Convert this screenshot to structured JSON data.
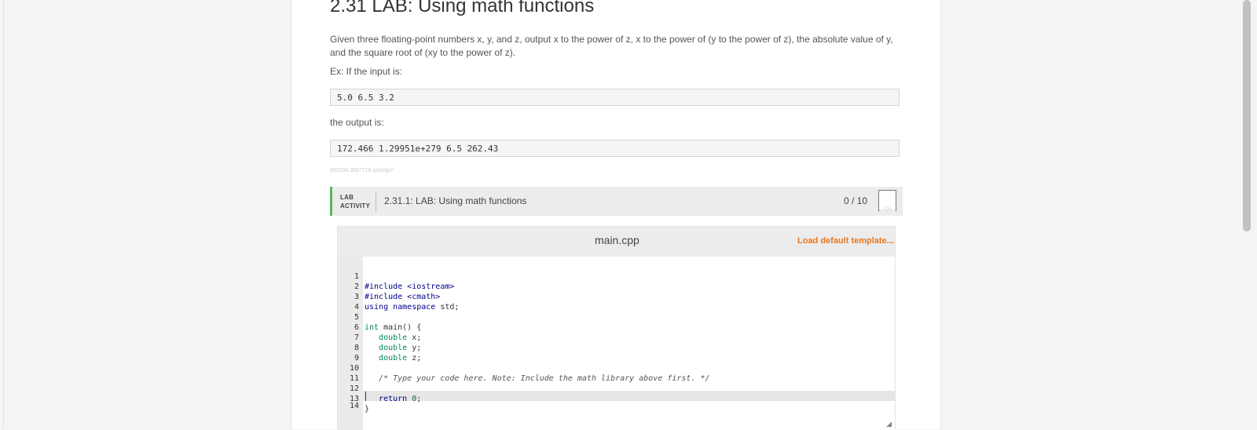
{
  "section": {
    "title": "2.31 LAB: Using math functions",
    "description": "Given three floating-point numbers x, y, and z, output x to the power of z, x to the power of (y to the power of z), the absolute value of y, and the square root of (xy to the power of z).",
    "example_label": "Ex: If the input is:",
    "example_input": "5.0 6.5 3.2",
    "output_label": "the output is:",
    "example_output": "172.466 1.29951e+279 6.5 262.43",
    "content_id": "493204.3587718.qx3zqy7"
  },
  "lab": {
    "tag_line1": "LAB",
    "tag_line2": "ACTIVITY",
    "title": "2.31.1: LAB: Using math functions",
    "score": "0 / 10"
  },
  "editor": {
    "filename": "main.cpp",
    "load_template": "Load default template...",
    "line_numbers": [
      "1",
      "2",
      "3",
      "4",
      "5",
      "6",
      "7",
      "8",
      "9",
      "10",
      "11",
      "12",
      "13",
      "14"
    ],
    "lines": [
      {
        "a": "#include <iostream>"
      },
      {
        "a": "#include <cmath>"
      },
      {
        "a": "using namespace",
        "b": " std;"
      },
      {},
      {
        "a": "int",
        "b": " main() {"
      },
      {
        "a": "   double",
        "b": " x;"
      },
      {
        "a": "   double",
        "b": " y;"
      },
      {
        "a": "   double",
        "b": " z;"
      },
      {},
      {
        "a": "   /* Type your code here. Note: Include the math library above first. */"
      },
      {},
      {
        "a": "   return",
        "b": " 0",
        "c": ";"
      },
      {
        "a": "}"
      },
      {}
    ]
  },
  "colors": {
    "accent_green": "#5cb85c",
    "link_orange": "#e87722",
    "keyword_blue": "#00008b",
    "type_green": "#008855"
  }
}
